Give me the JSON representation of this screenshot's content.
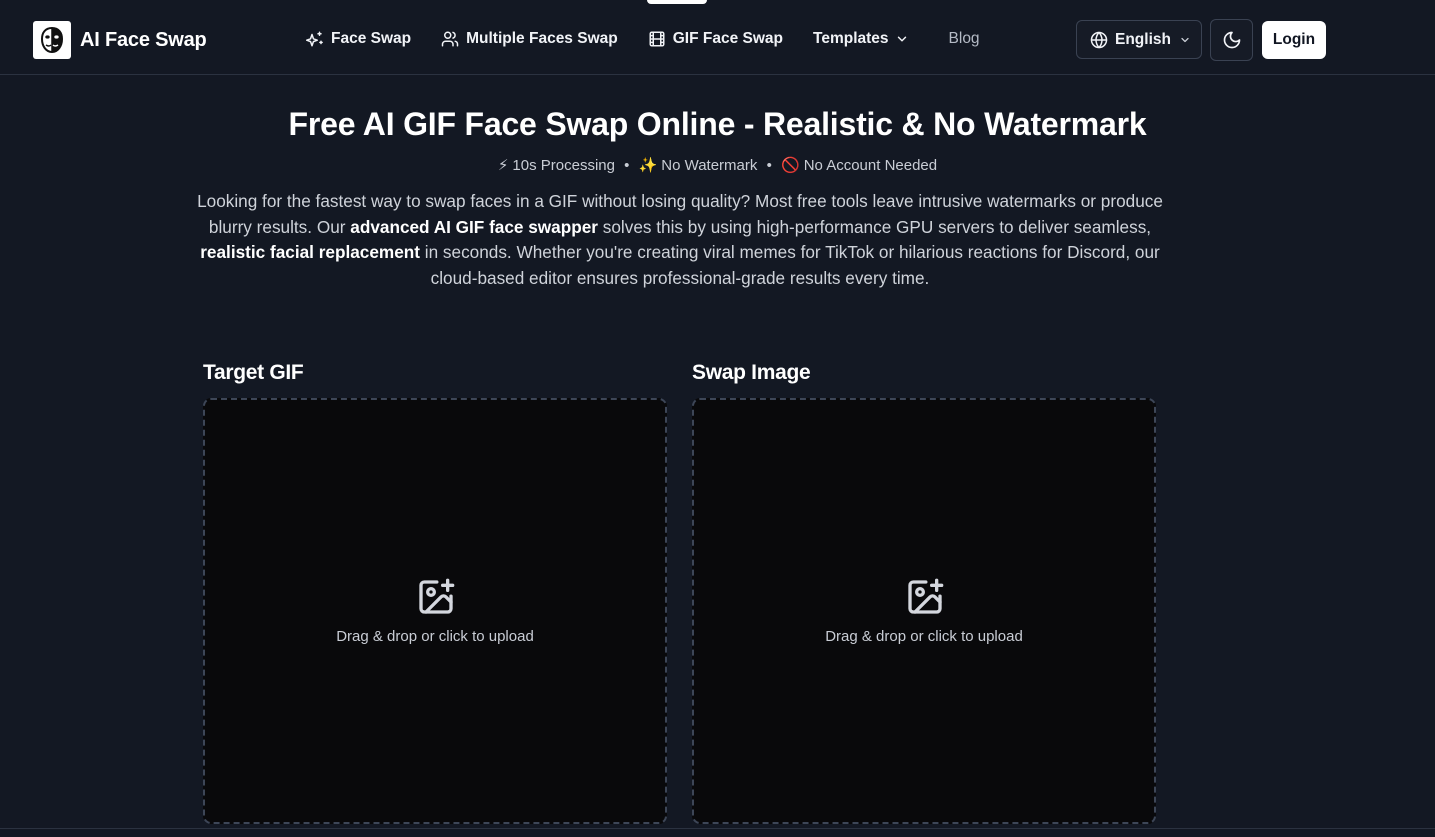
{
  "brand": {
    "name": "AI Face Swap"
  },
  "nav": {
    "items": [
      {
        "label": "Face Swap",
        "icon": "sparkles-icon"
      },
      {
        "label": "Multiple Faces Swap",
        "icon": "users-icon"
      },
      {
        "label": "GIF Face Swap",
        "icon": "film-icon"
      },
      {
        "label": "Templates",
        "icon": "chevron-down-icon"
      },
      {
        "label": "Blog"
      }
    ]
  },
  "language": {
    "label": "English",
    "icon": "globe-icon"
  },
  "theme_toggle": {
    "icon": "moon-icon"
  },
  "login": {
    "label": "Login"
  },
  "hero": {
    "title": "Free AI GIF Face Swap Online - Realistic & No Watermark",
    "features": [
      {
        "emoji": "⚡",
        "text": "10s Processing"
      },
      {
        "emoji": "✨",
        "text": "No Watermark"
      },
      {
        "emoji": "🚫",
        "text": "No Account Needed"
      }
    ],
    "separator": "•",
    "description": {
      "p1": "Looking for the fastest way to swap faces in a GIF without losing quality? Most free tools leave intrusive watermarks or produce blurry results. Our ",
      "b1": "advanced AI GIF face swapper",
      "p2": " solves this by using high-performance GPU servers to deliver seamless, ",
      "b2": "realistic facial replacement",
      "p3": " in seconds. Whether you're creating viral memes for TikTok or hilarious reactions for Discord, our cloud-based editor ensures professional-grade results every time."
    }
  },
  "upload": {
    "target": {
      "label": "Target GIF",
      "hint": "Drag & drop or click to upload",
      "icon": "image-plus-icon"
    },
    "swap": {
      "label": "Swap Image",
      "hint": "Drag & drop or click to upload",
      "icon": "image-plus-icon"
    }
  },
  "colors": {
    "background": "#131823",
    "dropzone": "#09090b",
    "dashed_border": "#3d4657",
    "text": "#e7e9ee",
    "button_light": "#ffffff"
  }
}
